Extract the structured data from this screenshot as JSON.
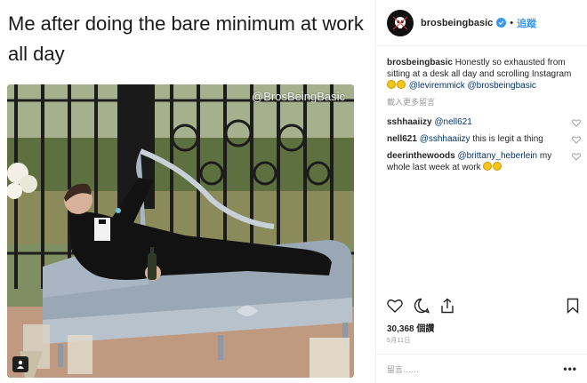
{
  "meme": {
    "caption": "Me after doing the bare minimum at work all day",
    "watermark": "@BrosBeingBasic"
  },
  "header": {
    "username": "brosbeingbasic",
    "dot": "•",
    "follow_label": "追蹤",
    "verified_color": "#3897f0"
  },
  "caption": {
    "username": "brosbeingbasic",
    "text": "Honestly so exhausted from sitting at a desk all day and scrolling Instagram",
    "mention1": "@leviremmick",
    "mention2": "@brosbeingbasic"
  },
  "view_more": "載入更多留言",
  "comments": [
    {
      "username": "sshhaaiizy",
      "text": "@nell621"
    },
    {
      "username": "nell621",
      "mention": "@sshhaaiizy",
      "text": "this is legit a thing"
    },
    {
      "username": "deerinthewoods",
      "mention": "@brittany_heberlein",
      "text": "my whole last week at work"
    }
  ],
  "likes": "30,368 個讚",
  "date": "5月11日",
  "add_comment_placeholder": "留言……",
  "more": "•••",
  "icons": {
    "like": "heart-icon",
    "comment": "comment-icon",
    "share": "share-icon",
    "save": "bookmark-icon",
    "comment_like": "heart-icon",
    "emoji": "grinning-emoji-icon"
  },
  "colors": {
    "link": "#003569",
    "accent": "#3897f0",
    "muted": "#999999"
  }
}
